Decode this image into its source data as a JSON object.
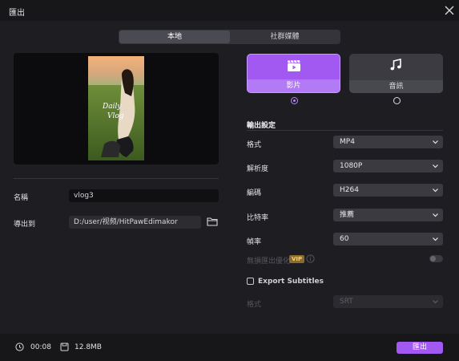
{
  "window": {
    "title": "匯出"
  },
  "tabs": [
    {
      "label": "本地",
      "active": true
    },
    {
      "label": "社群媒體",
      "active": false
    }
  ],
  "preview": {
    "overlay_text_1": "Daily",
    "overlay_text_2": "Vlog"
  },
  "form": {
    "name_label": "名稱",
    "name_value": "vlog3",
    "export_to_label": "導出到",
    "export_path": "D:/user/视频/HitPawEdimakor"
  },
  "format_cards": [
    {
      "label": "影片",
      "icon": "video-clapper-icon",
      "selected": true
    },
    {
      "label": "音訊",
      "icon": "music-note-icon",
      "selected": false
    }
  ],
  "settings": {
    "title": "輸出設定",
    "rows": [
      {
        "label": "格式",
        "value": "MP4"
      },
      {
        "label": "解析度",
        "value": "1080P"
      },
      {
        "label": "編碼",
        "value": "H264"
      },
      {
        "label": "比特率",
        "value": "推薦"
      },
      {
        "label": "幀率",
        "value": "60"
      }
    ],
    "lossless_label": "無損匯出優化",
    "vip_badge": "VIP",
    "lossless_enabled": false,
    "subtitles_label": "Export Subtitles",
    "subtitles_checked": false,
    "subtitle_format_label": "格式",
    "subtitle_format_value": "SRT"
  },
  "footer": {
    "duration": "00:08",
    "size": "12.8MB",
    "export_button": "匯出"
  },
  "colors": {
    "accent": "#a259f2",
    "background": "#1e1e22",
    "titlebar": "#17171a"
  }
}
